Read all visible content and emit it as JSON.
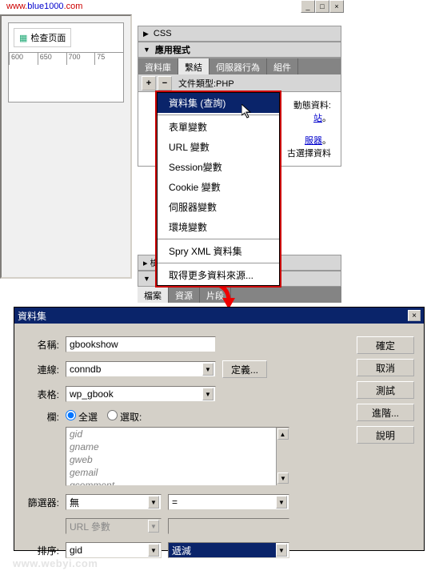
{
  "url": {
    "prefix": "www.",
    "mid": "blue1000",
    "suffix": ".com"
  },
  "check_page": "检查页面",
  "ruler": [
    "600",
    "650",
    "700",
    "75"
  ],
  "panels": {
    "css": "CSS",
    "app": "應用程式",
    "files_garbled": "▸ 檢視收藏",
    "files": "檔案",
    "files_tabs": [
      "檔案",
      "資源",
      "片段"
    ]
  },
  "tabs": [
    "資料庫",
    "繫結",
    "伺服器行為",
    "組件"
  ],
  "doctype": "文件類型:PHP",
  "panel_text": {
    "line1": "動態資料:",
    "link1": "站",
    "suffix1": "。",
    "link2": "服器",
    "suffix2": "。",
    "line3": "古選擇資料"
  },
  "menu": {
    "items": [
      "資料集 (查詢)",
      "表單變數",
      "URL 變數",
      "Session變數",
      "Cookie 變數",
      "伺服器變數",
      "環境變數",
      "Spry XML 資料集",
      "取得更多資料來源..."
    ]
  },
  "arrow_label": "arrow",
  "dialog": {
    "title": "資料集",
    "labels": {
      "name": "名稱:",
      "conn": "連線:",
      "table": "表格:",
      "columns": "欄:",
      "filter": "篩選器:",
      "sort": "排序:"
    },
    "values": {
      "name": "gbookshow",
      "conn": "conndb",
      "table": "wp_gbook",
      "filter1": "無",
      "filter2": "=",
      "filter3": "URL 參數",
      "filter4": "",
      "sort1": "gid",
      "sort2": "遞減"
    },
    "radio": {
      "all": "全選",
      "select": "選取:"
    },
    "columns_list": [
      "gid",
      "gname",
      "gweb",
      "gemail",
      "gcomment"
    ],
    "define_btn": "定義...",
    "buttons": [
      "確定",
      "取消",
      "測試",
      "進階...",
      "說明"
    ]
  },
  "watermark": "www.webyi.com"
}
